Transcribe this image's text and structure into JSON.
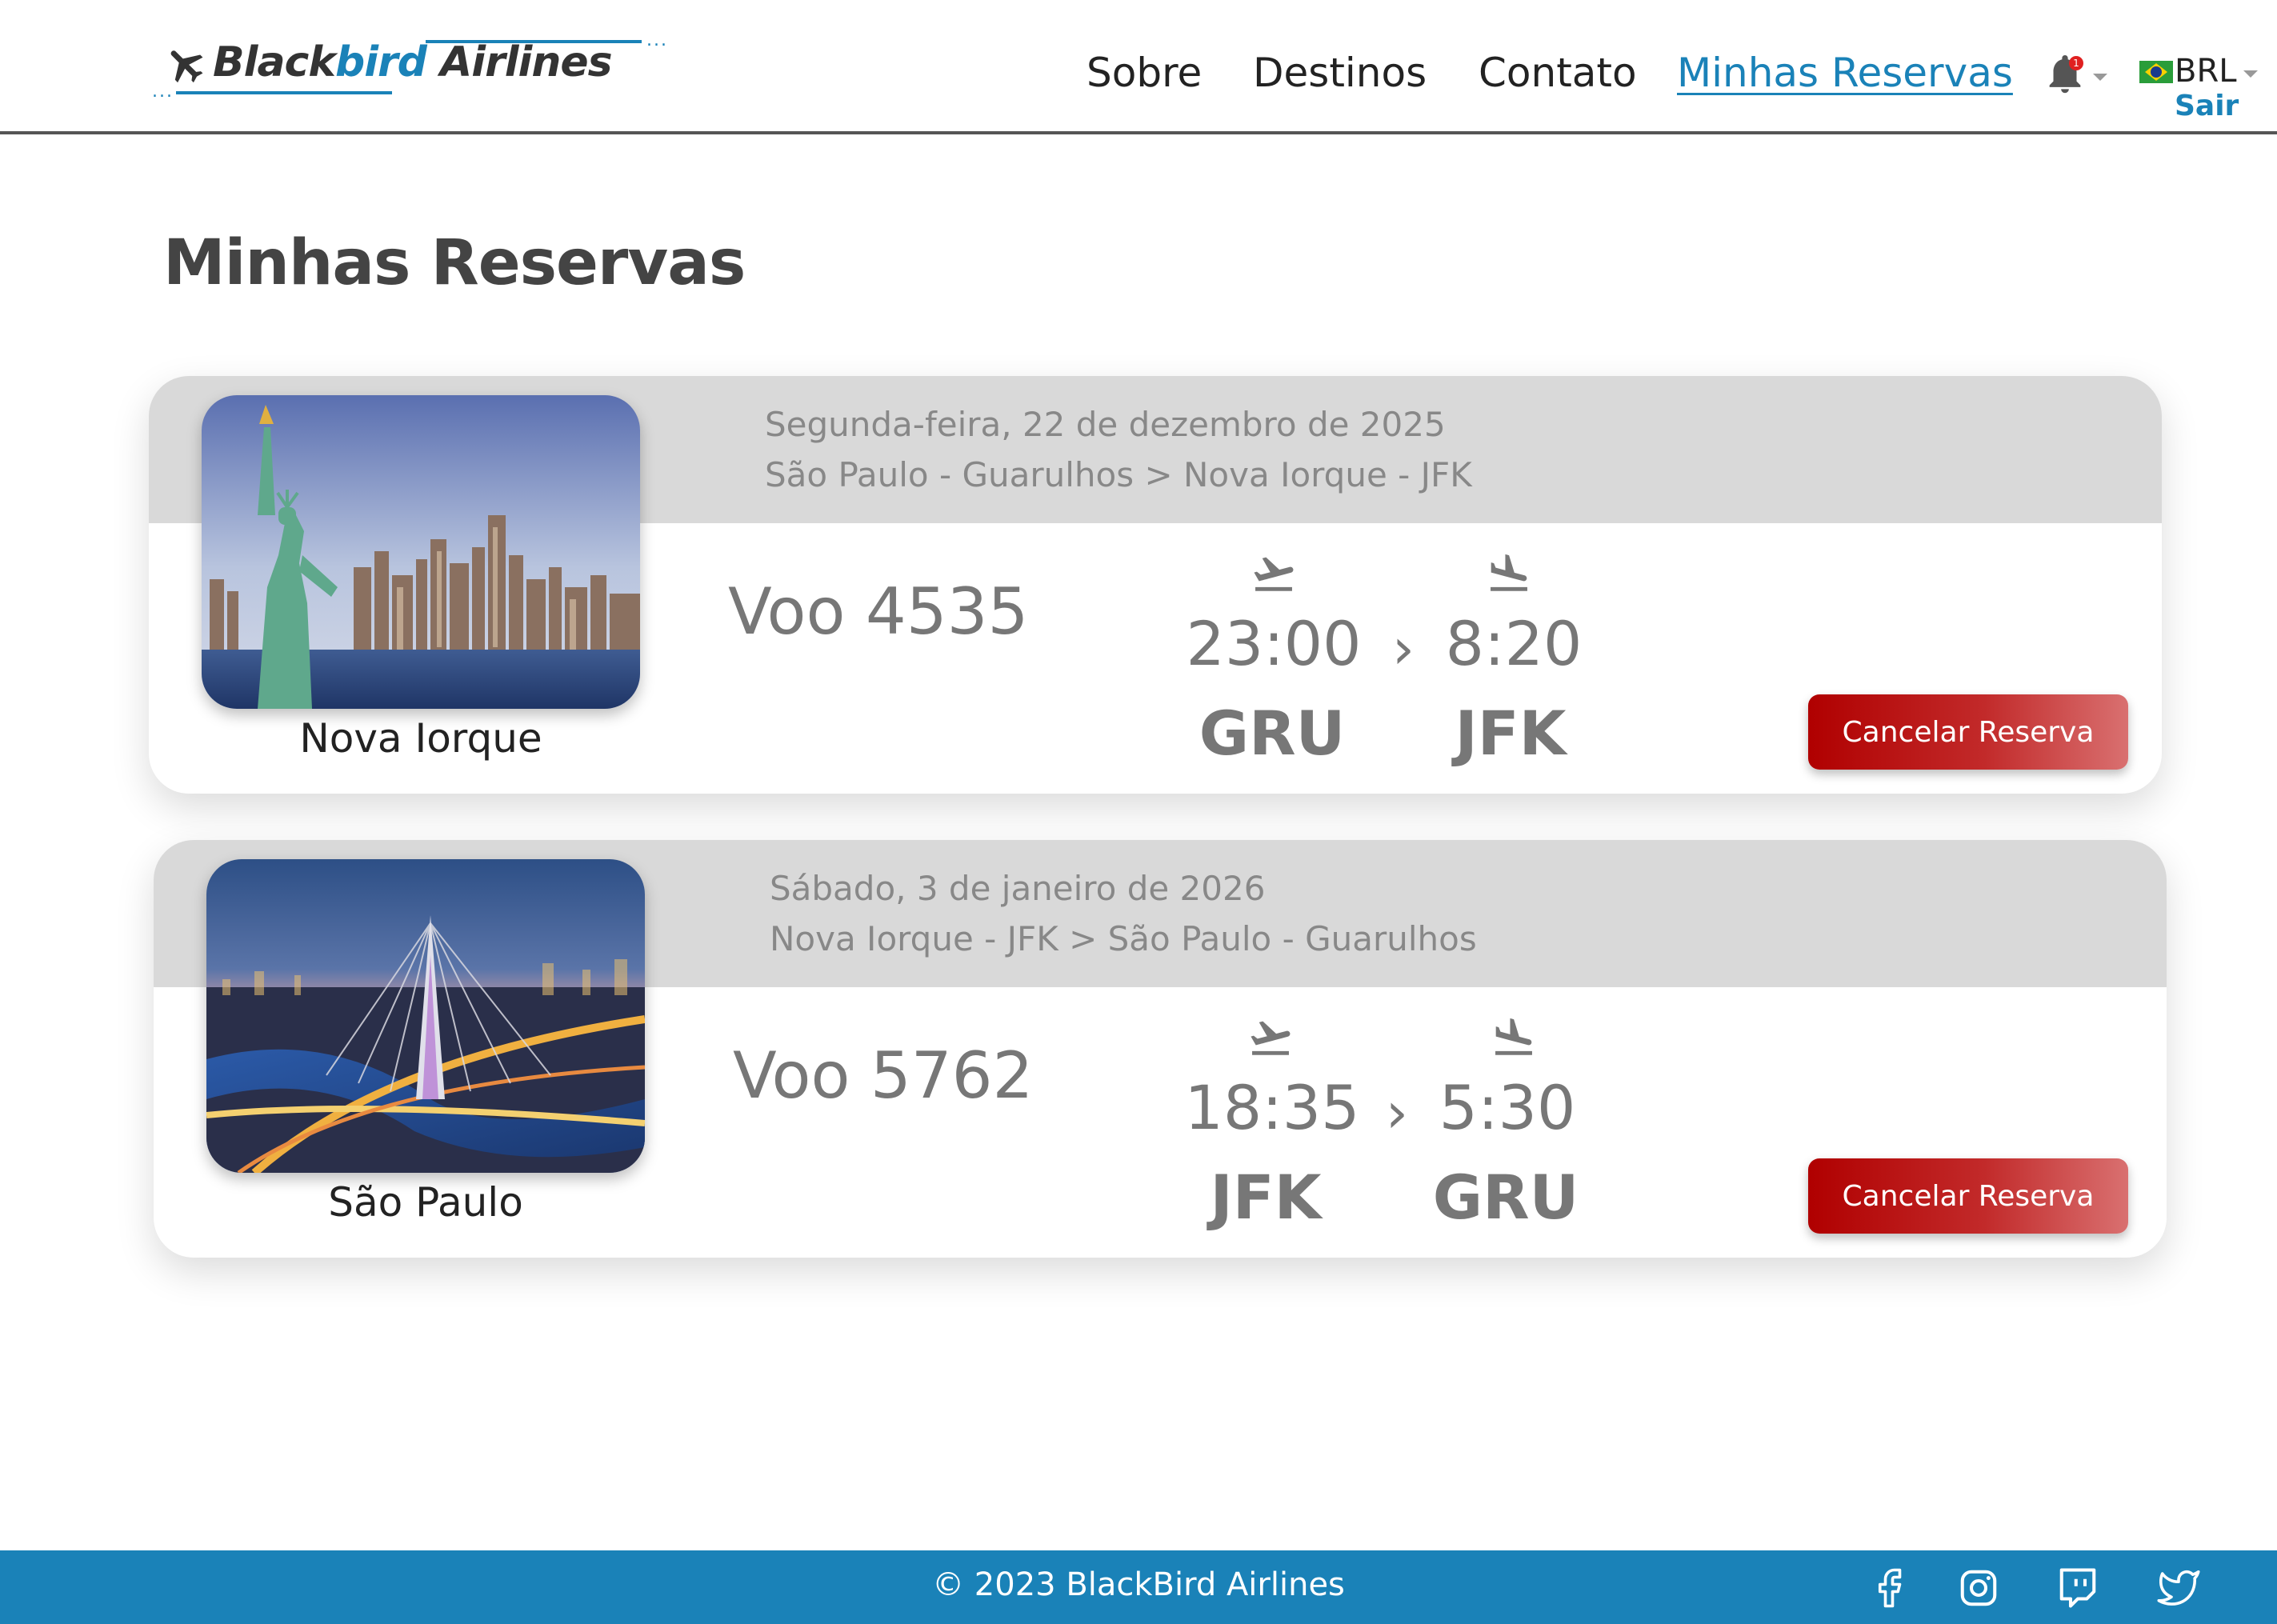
{
  "brand": {
    "name_part1": "Black",
    "name_part2": "bird",
    "name_part3": " Airlines",
    "accent_color": "#1a82b8"
  },
  "nav": {
    "items": [
      {
        "label": "Sobre",
        "active": false
      },
      {
        "label": "Destinos",
        "active": false
      },
      {
        "label": "Contato",
        "active": false
      },
      {
        "label": "Minhas Reservas",
        "active": true
      }
    ],
    "notifications_count": "1",
    "currency": "BRL",
    "logout_label": "Sair"
  },
  "page": {
    "title": "Minhas Reservas"
  },
  "reservations": [
    {
      "image": "statue-of-liberty-new-york",
      "city": "Nova Iorque",
      "date": "Segunda-feira, 22 de dezembro de 2025",
      "route": "São Paulo - Guarulhos > Nova Iorque - JFK",
      "flight": "Voo 4535",
      "departure_time": "23:00",
      "arrival_time": "8:20",
      "origin": "GRU",
      "destination": "JFK",
      "separator": "›",
      "cancel_label": "Cancelar Reserva"
    },
    {
      "image": "octavio-frias-bridge-sao-paulo",
      "city": "São Paulo",
      "date": "Sábado, 3 de janeiro de 2026",
      "route": "Nova Iorque - JFK > São Paulo - Guarulhos",
      "flight": "Voo 5762",
      "departure_time": "18:35",
      "arrival_time": "5:30",
      "origin": "JFK",
      "destination": "GRU",
      "separator": "›",
      "cancel_label": "Cancelar Reserva"
    }
  ],
  "footer": {
    "copyright": "© 2023 BlackBird Airlines",
    "social": [
      "facebook-icon",
      "instagram-icon",
      "twitch-icon",
      "twitter-icon"
    ],
    "background": "#1a82b8"
  },
  "colors": {
    "cancel_button": "#b00000",
    "card_header": "#d9d9d9"
  }
}
